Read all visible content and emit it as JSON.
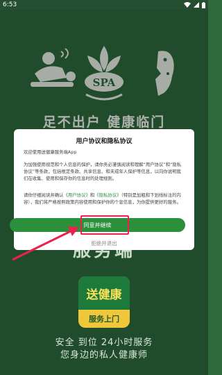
{
  "status_bar": {
    "time": "6:53"
  },
  "background": {
    "slogan": "足不出户  健康临门",
    "service_text": "服务端",
    "app_tile": {
      "line1": "送健康",
      "line2": "服务上门"
    },
    "tagline1": "安全  到位  24小时服务",
    "tagline2": "您身边的私人健康师"
  },
  "dialog": {
    "title": "用户协议和隐私协议",
    "welcome": "欢迎使用送健康服务端App",
    "paragraph1": "为加强使用视范和个人信息的保护，请你务必谨慎阅读和理解“用户协议”和“隐私协议”等条款，包括根定条款、共享信息、和未成年人保护等信息，以向你说明我们在收集、使用和保存你的信息时的处理规则。",
    "paragraph2_prefix": "请你仔细阅读并确认",
    "user_agreement_link": "《用户协议》",
    "and_text": "和",
    "privacy_link": "《隐私协议》",
    "paragraph2_suffix": "（特别是加粗和下划线标注的内容），我们将严格按照政策内容使用和保护你的个息信息，为你提供更好的服务。",
    "agree_button": "同意并继续",
    "reject_button": "拒绝并退出"
  },
  "colors": {
    "background": "#2f6a3d",
    "accent": "#2b8f3c",
    "highlight": "#ef1e4d"
  }
}
